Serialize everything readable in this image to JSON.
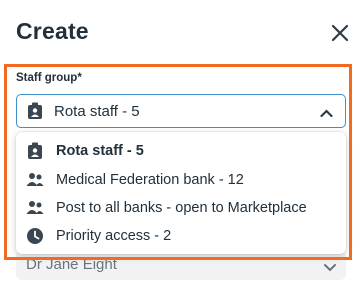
{
  "header": {
    "title": "Create"
  },
  "form": {
    "staff_group": {
      "label": "Staff group*",
      "value": "Rota staff - 5",
      "options": [
        {
          "label": "Rota staff - 5",
          "icon": "badge-icon",
          "selected": true
        },
        {
          "label": "Medical Federation bank - 12",
          "icon": "people-icon",
          "selected": false
        },
        {
          "label": "Post to all banks - open to Marketplace",
          "icon": "people-icon",
          "selected": false
        },
        {
          "label": "Priority access - 2",
          "icon": "clock-icon",
          "selected": false
        }
      ]
    },
    "next_field": {
      "value": "Dr Jane Eight"
    }
  },
  "colors": {
    "highlight": "#f06a20",
    "focus_border": "#3f8fcb",
    "text": "#22303b"
  }
}
